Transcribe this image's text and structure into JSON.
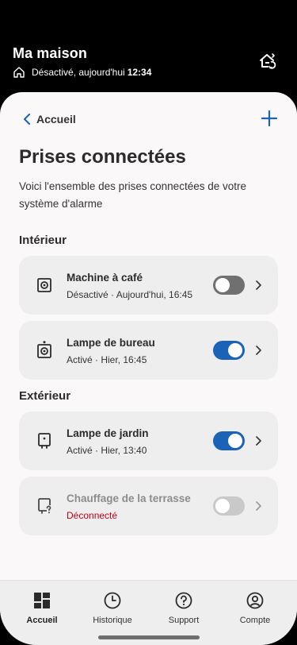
{
  "header": {
    "home_name": "Ma maison",
    "status_text": "Désactivé, aujourd'hui",
    "status_time": "12:34"
  },
  "nav": {
    "back_label": "Accueil"
  },
  "page": {
    "title": "Prises connectées",
    "description": "Voici l'ensemble des prises connectées de votre système d'alarme"
  },
  "sections": {
    "interior": "Intérieur",
    "exterior": "Extérieur"
  },
  "devices": [
    {
      "name": "Machine à café",
      "status": "Désactivé · Aujourd'hui, 16:45",
      "state": "off"
    },
    {
      "name": "Lampe de bureau",
      "status": "Activé · Hier, 16:45",
      "state": "on"
    },
    {
      "name": "Lampe de jardin",
      "status": "Activé · Hier, 13:40",
      "state": "on"
    },
    {
      "name": "Chauffage de la terrasse",
      "status": "Déconnecté",
      "state": "disconnected"
    }
  ],
  "tabs": [
    {
      "label": "Accueil",
      "icon": "dashboard-icon",
      "active": true
    },
    {
      "label": "Historique",
      "icon": "clock-icon",
      "active": false
    },
    {
      "label": "Support",
      "icon": "help-icon",
      "active": false
    },
    {
      "label": "Compte",
      "icon": "user-icon",
      "active": false
    }
  ],
  "colors": {
    "accent": "#1a63b6",
    "error": "#c0001a",
    "header_bg": "#000000",
    "sheet_bg": "#faf8f9",
    "card_bg": "#efeeef"
  }
}
